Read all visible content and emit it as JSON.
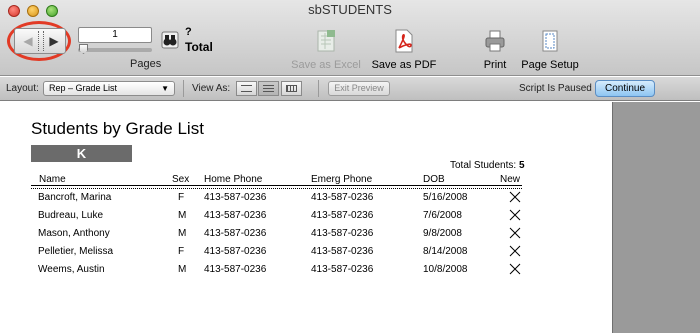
{
  "window": {
    "title": "sbSTUDENTS"
  },
  "toolbar": {
    "page_number": "1",
    "pages_label": "Pages",
    "total_count": "?",
    "total_label": "Total",
    "tools": [
      {
        "label": "Save as Excel",
        "icon": "excel-icon",
        "enabled": false
      },
      {
        "label": "Save as PDF",
        "icon": "pdf-icon",
        "enabled": true
      },
      {
        "label": "Print",
        "icon": "printer-icon",
        "enabled": true
      },
      {
        "label": "Page Setup",
        "icon": "page-setup-icon",
        "enabled": true
      }
    ]
  },
  "layout_bar": {
    "layout_label": "Layout:",
    "layout_value": "Rep – Grade List",
    "view_as_label": "View As:",
    "exit_preview": "Exit Preview",
    "script_status": "Script Is Paused",
    "continue": "Continue"
  },
  "report": {
    "title": "Students by Grade List",
    "grade": "K",
    "total_students_label": "Total Students:",
    "total_students_value": "5",
    "columns": [
      "Name",
      "Sex",
      "Home Phone",
      "Emerg Phone",
      "DOB",
      "New"
    ],
    "rows": [
      {
        "name": "Bancroft, Marina",
        "sex": "F",
        "home": "413-587-0236",
        "emerg": "413-587-0236",
        "dob": "5/16/2008"
      },
      {
        "name": "Budreau, Luke",
        "sex": "M",
        "home": "413-587-0236",
        "emerg": "413-587-0236",
        "dob": "7/6/2008"
      },
      {
        "name": "Mason, Anthony",
        "sex": "M",
        "home": "413-587-0236",
        "emerg": "413-587-0236",
        "dob": "9/8/2008"
      },
      {
        "name": "Pelletier, Melissa",
        "sex": "F",
        "home": "413-587-0236",
        "emerg": "413-587-0236",
        "dob": "8/14/2008"
      },
      {
        "name": "Weems, Austin",
        "sex": "M",
        "home": "413-587-0236",
        "emerg": "413-587-0236",
        "dob": "10/8/2008"
      }
    ]
  },
  "colors": {
    "highlight_ring": "#e23a25",
    "grade_bar": "#6b6b6b",
    "continue_button": "#8ec5f2"
  }
}
